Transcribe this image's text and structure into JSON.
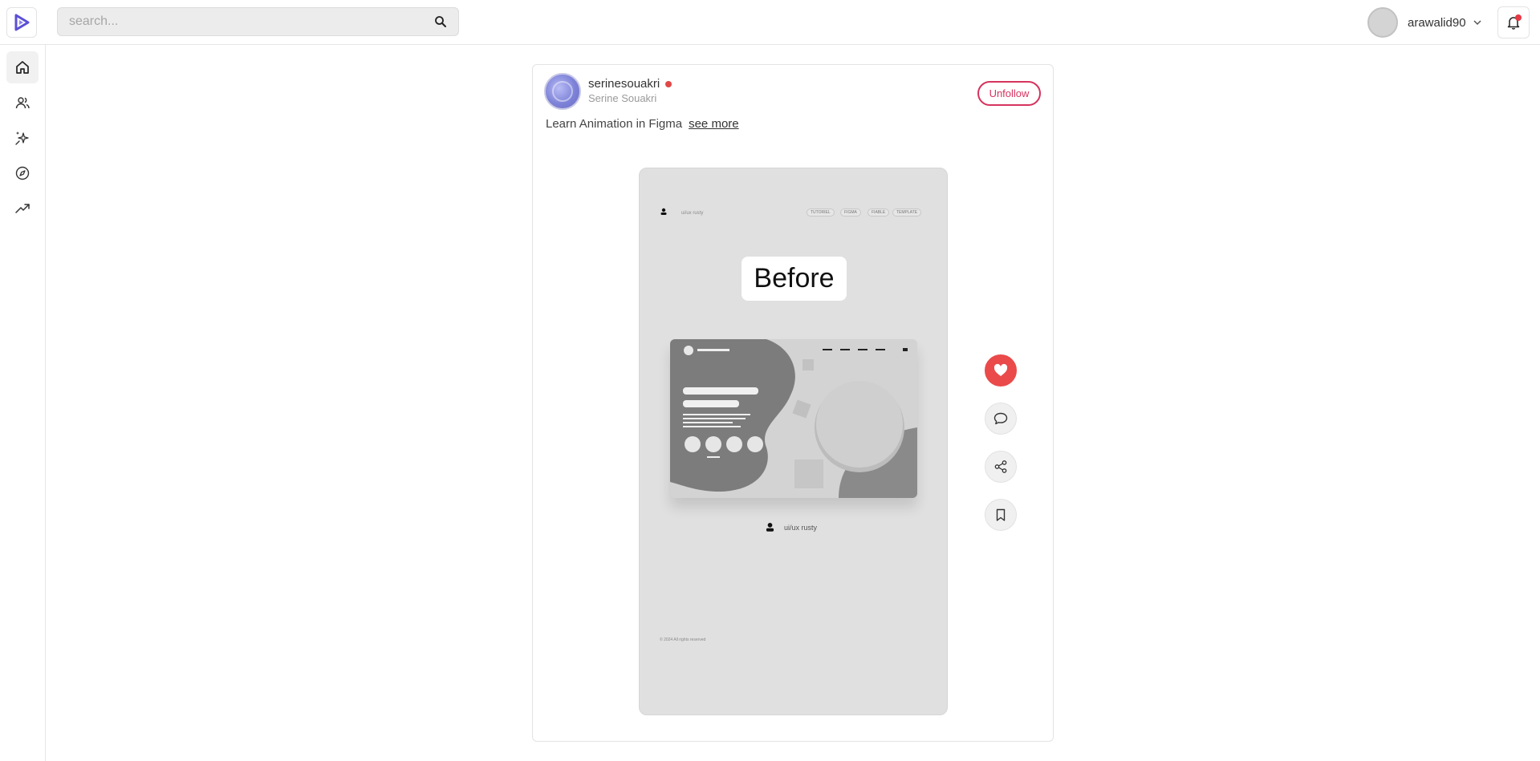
{
  "topbar": {
    "search_placeholder": "search...",
    "username": "arawalid90",
    "accent_color": "#5b4fd6",
    "notification_dot_color": "#e53945"
  },
  "sidebar": {
    "items": [
      {
        "icon": "home-icon",
        "active": true
      },
      {
        "icon": "users-icon",
        "active": false
      },
      {
        "icon": "sparkles-icon",
        "active": false
      },
      {
        "icon": "compass-icon",
        "active": false
      },
      {
        "icon": "trending-icon",
        "active": false
      }
    ]
  },
  "post": {
    "handle": "serinesouakri",
    "display_name": "Serine Souakri",
    "follow_button_label": "Unfollow",
    "caption": "Learn Animation in Figma",
    "see_more_label": "see more",
    "media": {
      "brand_label": "ui/ux rusty",
      "nav_pills": [
        "TUTORIEL",
        "FIGMA",
        "FIABLE",
        "TEMPLATE"
      ],
      "title": "Before",
      "footer_brand": "ui/ux rusty",
      "copyright": "© 2024 All rights reserved"
    },
    "actions": [
      {
        "icon": "heart-icon",
        "active": true
      },
      {
        "icon": "comment-icon",
        "active": false
      },
      {
        "icon": "share-icon",
        "active": false
      },
      {
        "icon": "bookmark-icon",
        "active": false
      }
    ],
    "like_color": "#ea4a4a",
    "unfollow_color": "#d6335e"
  }
}
